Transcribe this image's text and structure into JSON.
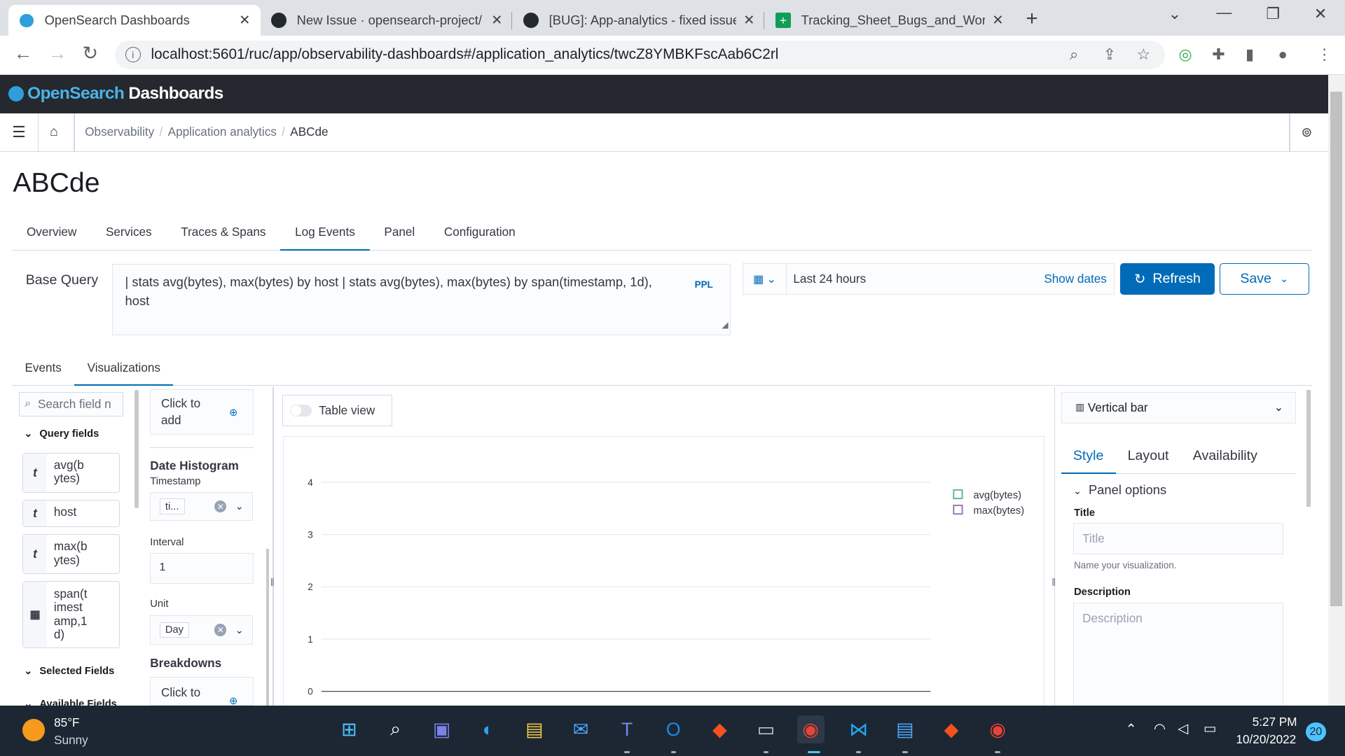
{
  "browser": {
    "tabs": [
      {
        "label": "OpenSearch Dashboards",
        "favicon": "opensearch-icon",
        "active": true
      },
      {
        "label": "New Issue · opensearch-project/",
        "favicon": "github-icon"
      },
      {
        "label": "[BUG]: App-analytics - fixed issue",
        "favicon": "github-icon"
      },
      {
        "label": "Tracking_Sheet_Bugs_and_Workfl",
        "favicon": "sheets-icon"
      }
    ],
    "url": "localhost:5601/ruc/app/observability-dashboards#/application_analytics/twcZ8YMBKFscAab6C2rl"
  },
  "header": {
    "logo_a": "Open",
    "logo_b": "Search",
    "logo_c": " Dashboards"
  },
  "breadcrumbs": [
    "Observability",
    "Application analytics",
    "ABCde"
  ],
  "page_title": "ABCde",
  "main_tabs": [
    "Overview",
    "Services",
    "Traces & Spans",
    "Log Events",
    "Panel",
    "Configuration"
  ],
  "query": {
    "label": "Base Query",
    "text": "| stats avg(bytes), max(bytes) by host | stats avg(bytes), max(bytes) by span(timestamp, 1d), host",
    "language": "PPL",
    "time_range": "Last 24 hours",
    "show_dates": "Show dates",
    "refresh": "Refresh",
    "save": "Save"
  },
  "sub_tabs": [
    "Events",
    "Visualizations"
  ],
  "sidebar": {
    "search_placeholder": "Search field n",
    "query_fields_label": "Query fields",
    "fields": [
      {
        "type": "t",
        "name": "avg(b ytes)"
      },
      {
        "type": "t",
        "name": "host"
      },
      {
        "type": "t",
        "name": "max(b ytes)"
      },
      {
        "type": "calendar",
        "name": "span(t imest amp,1 d)"
      }
    ],
    "selected_fields_label": "Selected Fields",
    "available_fields_label": "Available Fields"
  },
  "config": {
    "click_to_add": "Click to add",
    "date_histogram": "Date Histogram",
    "timestamp_label": "Timestamp",
    "timestamp_value": "ti...",
    "interval_label": "Interval",
    "interval_value": "1",
    "unit_label": "Unit",
    "unit_value": "Day",
    "breakdowns": "Breakdowns",
    "click_to": "Click to"
  },
  "viz": {
    "table_view": "Table view"
  },
  "chart_data": {
    "type": "bar",
    "yticks": [
      "4",
      "3",
      "2",
      "1",
      "0"
    ],
    "series": [
      {
        "name": "avg(bytes)",
        "color": "#54b399",
        "values": []
      },
      {
        "name": "max(bytes)",
        "color": "#9170b8",
        "values": []
      }
    ]
  },
  "right_panel": {
    "viz_type": "Vertical bar",
    "tabs": [
      "Style",
      "Layout",
      "Availability"
    ],
    "panel_options": "Panel options",
    "title_label": "Title",
    "title_placeholder": "Title",
    "title_help": "Name your visualization.",
    "desc_label": "Description",
    "desc_placeholder": "Description"
  },
  "taskbar": {
    "temp": "85°F",
    "weather": "Sunny",
    "time": "5:27 PM",
    "date": "10/20/2022",
    "badge": "20"
  }
}
